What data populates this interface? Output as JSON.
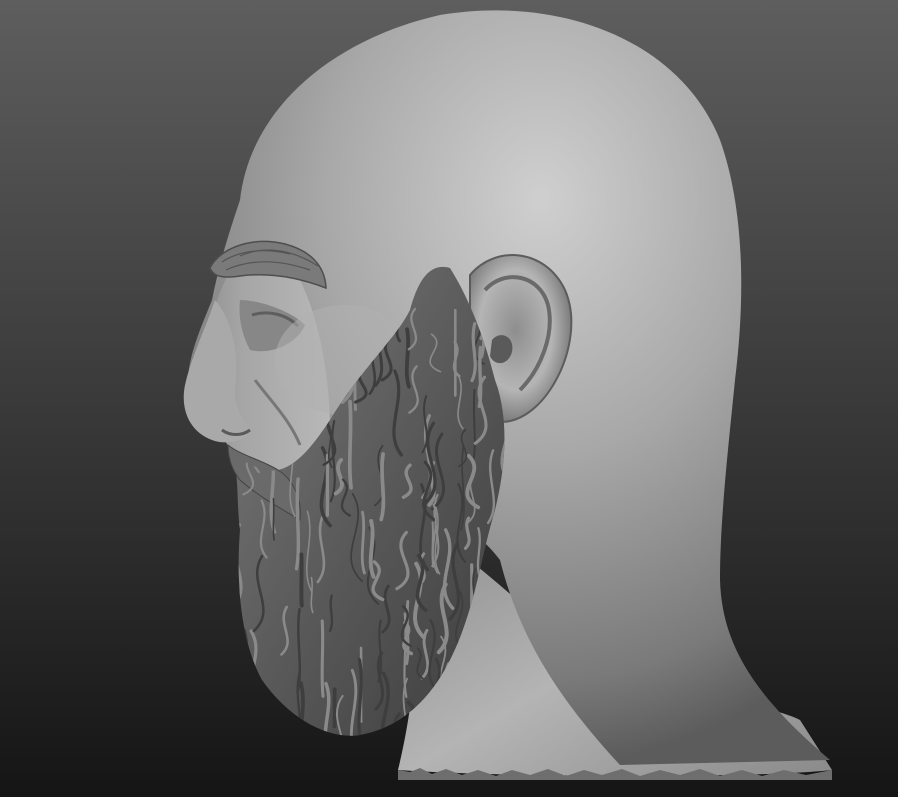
{
  "scene": {
    "subject": "sculpted-bald-bearded-head-profile",
    "facing": "left",
    "material": "matte-grey-clay",
    "colors": {
      "background_top": "#5e5e5e",
      "background_mid": "#3a3a3a",
      "background_bottom": "#151515",
      "clay_highlight": "#c9c9c9",
      "clay_mid": "#9a9a9a",
      "clay_shadow": "#5a5a5a",
      "beard_dark": "#3e3e3e",
      "beard_light": "#8a8a8a"
    }
  }
}
